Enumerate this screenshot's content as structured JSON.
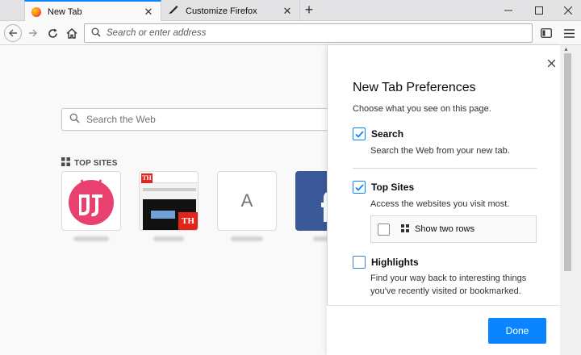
{
  "tabs": [
    {
      "title": "New Tab",
      "icon": "firefox-logo-icon",
      "active": true
    },
    {
      "title": "Customize Firefox",
      "icon": "paintbrush-icon",
      "active": false
    }
  ],
  "urlbar": {
    "placeholder": "Search or enter address"
  },
  "newtab": {
    "search_placeholder": "Search the Web",
    "top_sites_heading": "TOP SITES",
    "tiles": [
      {
        "letter": "",
        "kind": "android-logo"
      },
      {
        "letter": "",
        "kind": "screenshot"
      },
      {
        "letter": "A",
        "kind": "letter"
      },
      {
        "letter": "",
        "kind": "facebook"
      }
    ]
  },
  "prefs": {
    "title": "New Tab Preferences",
    "subtitle": "Choose what you see on this page.",
    "search": {
      "label": "Search",
      "description": "Search the Web from your new tab.",
      "checked": true
    },
    "top_sites": {
      "label": "Top Sites",
      "description": "Access the websites you visit most.",
      "checked": true
    },
    "two_rows": {
      "label": "Show two rows",
      "checked": false
    },
    "highlights": {
      "label": "Highlights",
      "description_line1": "Find your way back to interesting things",
      "description_line2": "you've recently visited or bookmarked.",
      "checked": false
    },
    "done_label": "Done"
  },
  "colors": {
    "accent": "#0a84ff",
    "android_pink": "#e8416f",
    "facebook_blue": "#3b5998",
    "brand_red": "#e1251b"
  }
}
